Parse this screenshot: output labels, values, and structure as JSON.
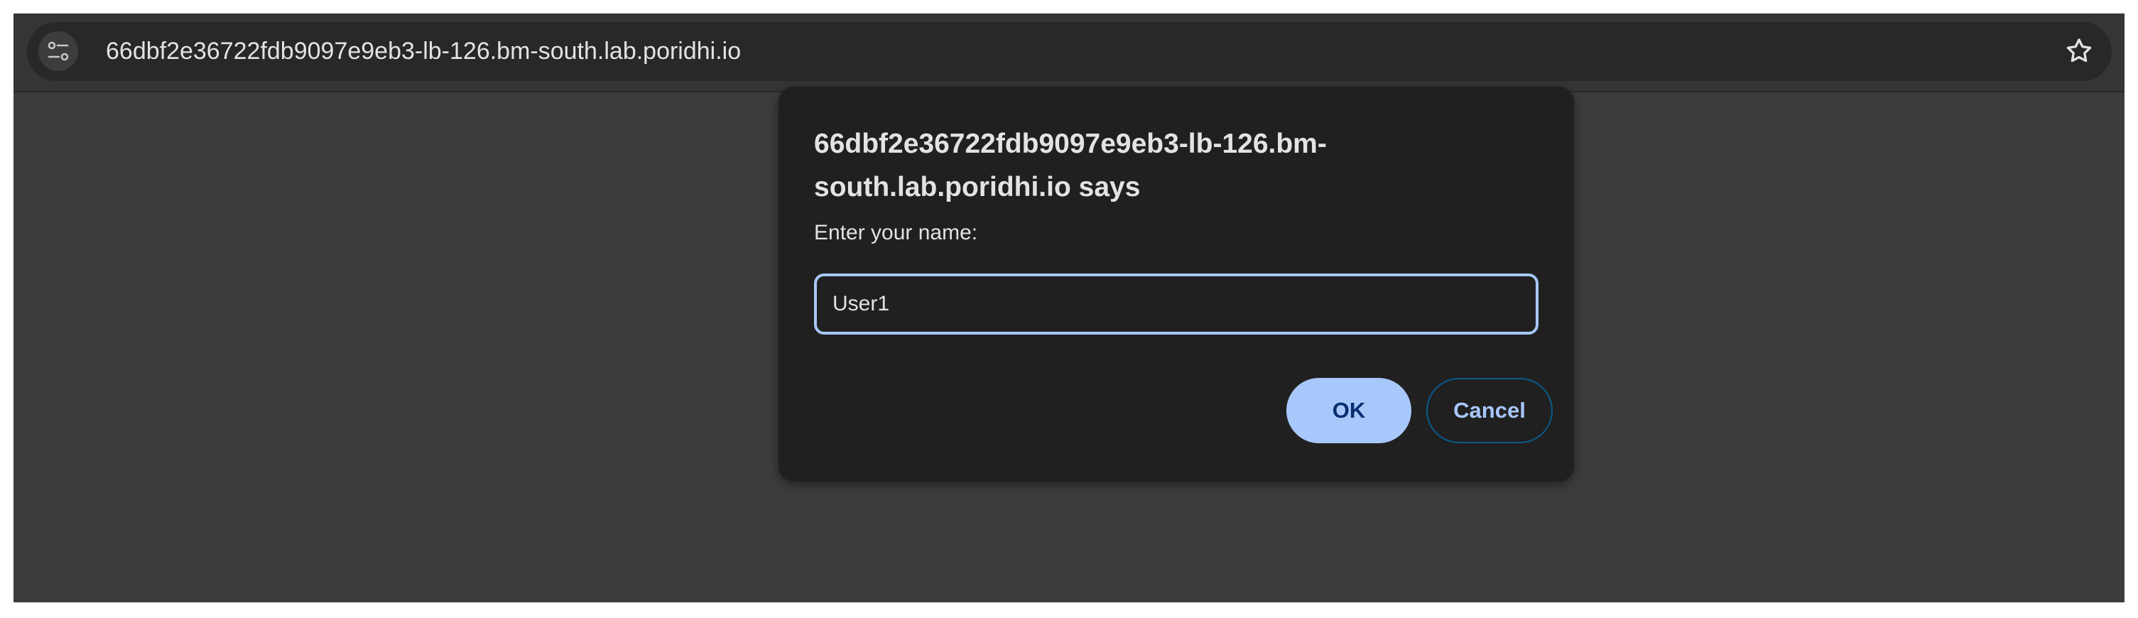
{
  "browser": {
    "address_bar": {
      "url": "66dbf2e36722fdb9097e9eb3-lb-126.bm-south.lab.poridhi.io",
      "site_info_icon": "tune-icon",
      "bookmark_icon": "star-outline-icon"
    }
  },
  "dialog": {
    "title_line1": "66dbf2e36722fdb9097e9eb3-lb-126.bm-",
    "title_line2": "south.lab.poridhi.io says",
    "message": "Enter your name:",
    "input_value": "User1",
    "ok_label": "OK",
    "cancel_label": "Cancel"
  },
  "colors": {
    "accent": "#a8c7fa",
    "dialog_bg": "#202020",
    "page_bg": "#3c3c3c"
  }
}
